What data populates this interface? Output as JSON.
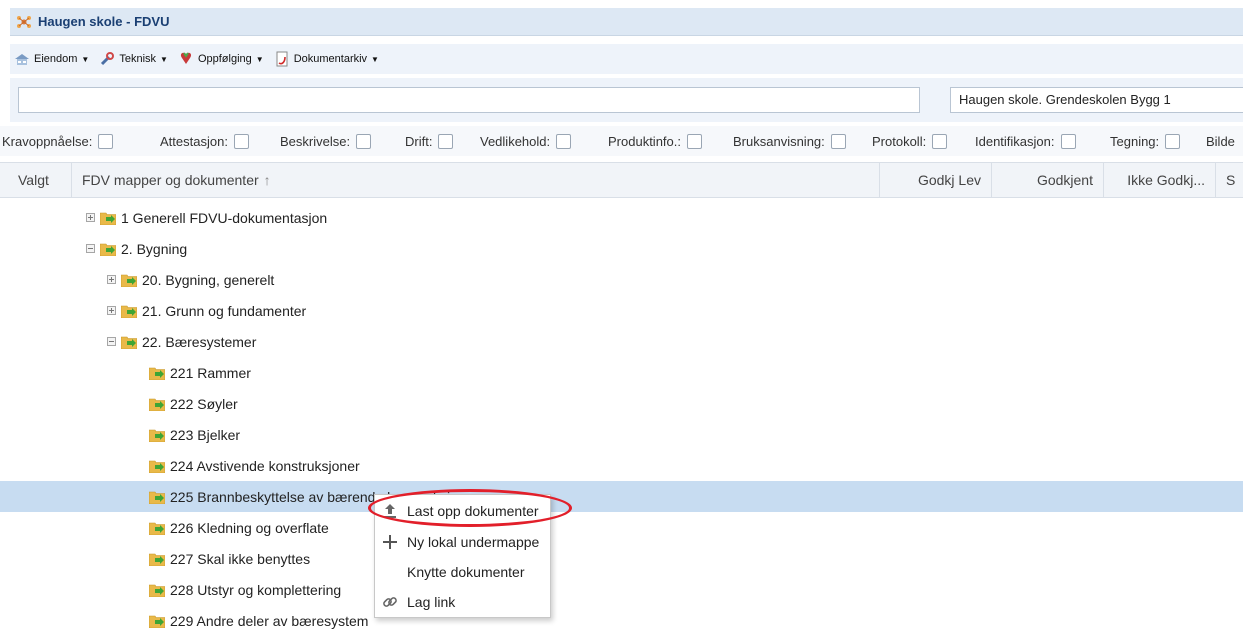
{
  "app": {
    "title": "Haugen skole - FDVU"
  },
  "menu": [
    {
      "label": "Eiendom",
      "icon": "property-icon"
    },
    {
      "label": "Teknisk",
      "icon": "technical-icon"
    },
    {
      "label": "Oppfølging",
      "icon": "followup-icon"
    },
    {
      "label": "Dokumentarkiv",
      "icon": "archive-icon"
    }
  ],
  "search": {
    "value": "",
    "placeholder": ""
  },
  "building": {
    "value": "Haugen skole. Grendeskolen Bygg 1"
  },
  "filters": [
    {
      "label": "Kravoppnåelse:",
      "checked": false
    },
    {
      "label": "Attestasjon:",
      "checked": false
    },
    {
      "label": "Beskrivelse:",
      "checked": false
    },
    {
      "label": "Drift:",
      "checked": false
    },
    {
      "label": "Vedlikehold:",
      "checked": false
    },
    {
      "label": "Produktinfo.:",
      "checked": false
    },
    {
      "label": "Bruksanvisning:",
      "checked": false
    },
    {
      "label": "Protokoll:",
      "checked": false
    },
    {
      "label": "Identifikasjon:",
      "checked": false
    },
    {
      "label": "Tegning:",
      "checked": false
    },
    {
      "label": "Bilde",
      "checked": false
    }
  ],
  "grid": {
    "columns": {
      "valgt": "Valgt",
      "tree": "FDV mapper og dokumenter",
      "sort_icon": "sort-up-arrow-icon",
      "godkj_lev": "Godkj Lev",
      "godkjent": "Godkjent",
      "ikke_godkj": "Ikke Godkj...",
      "s": "S"
    }
  },
  "tree": [
    {
      "label": "1 Generell FDVU-dokumentasjon",
      "expander": "plus"
    },
    {
      "label": "2. Bygning",
      "expander": "minus"
    },
    {
      "label": "20. Bygning, generelt",
      "expander": "plus"
    },
    {
      "label": "21. Grunn og fundamenter",
      "expander": "plus"
    },
    {
      "label": "22. Bæresystemer",
      "expander": "minus"
    },
    {
      "label": "221 Rammer",
      "expander": "none"
    },
    {
      "label": "222 Søyler",
      "expander": "none"
    },
    {
      "label": "223 Bjelker",
      "expander": "none"
    },
    {
      "label": "224 Avstivende konstruksjoner",
      "expander": "none"
    },
    {
      "label": "225 Brannbeskyttelse av bærende konstruksjoner",
      "expander": "none",
      "selected": true
    },
    {
      "label": "226 Kledning og overflate",
      "expander": "none"
    },
    {
      "label": "227 Skal ikke benyttes",
      "expander": "none"
    },
    {
      "label": "228 Utstyr og komplettering",
      "expander": "none"
    },
    {
      "label": "229 Andre deler av bæresystem",
      "expander": "none"
    }
  ],
  "context_menu": [
    {
      "label": "Last opp dokumenter",
      "icon": "upload-icon"
    },
    {
      "label": "Ny lokal undermappe",
      "icon": "plus-icon"
    },
    {
      "label": "Knytte dokumenter",
      "icon": ""
    },
    {
      "label": "Lag link",
      "icon": "link-icon"
    }
  ],
  "colors": {
    "selection": "#c7dcf1",
    "highlight_ring": "#e21f2a",
    "folder": "#e9b949",
    "folder_arrow": "#3fa535",
    "title_text": "#1a3f73"
  }
}
